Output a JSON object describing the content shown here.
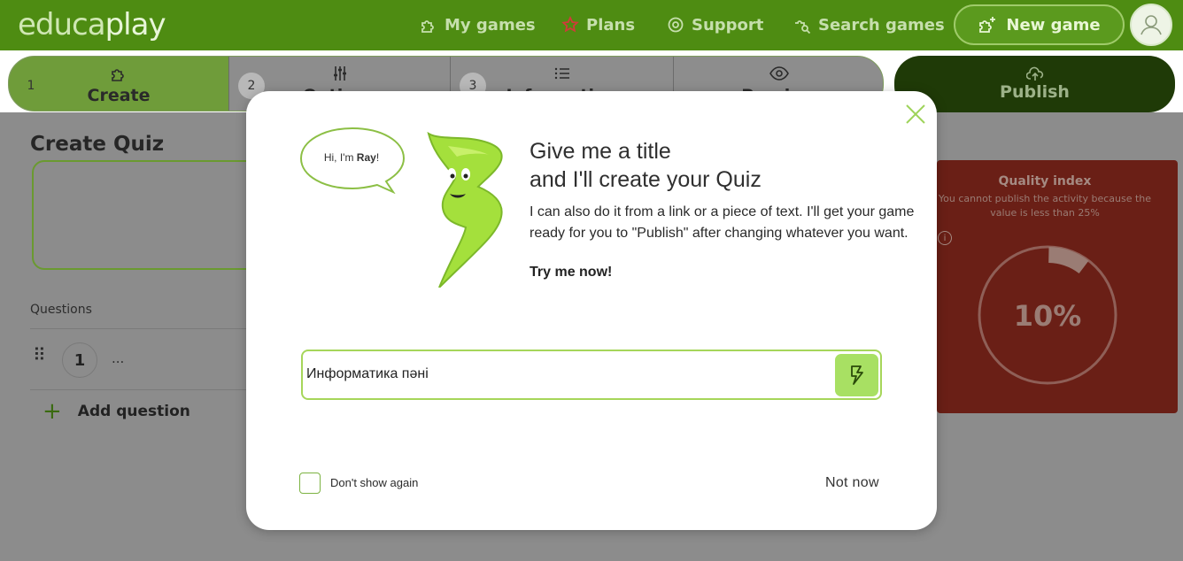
{
  "app": {
    "logo_main": "educa",
    "logo_accent": "play"
  },
  "nav": {
    "my_games": "My games",
    "plans": "Plans",
    "support": "Support",
    "search_games": "Search games",
    "new_game": "New game"
  },
  "steps": [
    {
      "num": "1",
      "label": "Create"
    },
    {
      "num": "2",
      "label": "Options"
    },
    {
      "num": "3",
      "label": "Information"
    },
    {
      "num": "",
      "label": "Preview"
    }
  ],
  "publish": {
    "label": "Publish"
  },
  "page": {
    "title": "Create Quiz",
    "questions_header": "Questions",
    "question_number": "1",
    "question_text": "...",
    "add_question": "Add question"
  },
  "quality": {
    "title": "Quality index",
    "subtitle": "You cannot publish the activity because the value is less than 25%",
    "value": "10%",
    "percent": 10
  },
  "modal": {
    "bubble_prefix": "Hi, I'm ",
    "bubble_name": "Ray",
    "bubble_suffix": "!",
    "heading_line1": "Give me a title",
    "heading_line2": "and I'll create your Quiz",
    "paragraph": "I can also do it from a link or a piece of text. I'll get your game ready for you to \"Publish\" after changing whatever you want.",
    "try_now": "Try me now!",
    "input_value": "Информатика пәні",
    "dont_show": "Don't show again",
    "not_now": "Not now"
  },
  "colors": {
    "brand_green": "#4e8c12",
    "accent_lime": "#a8e063",
    "publish_dark": "#1f3a07",
    "quality_red": "#6a1f16"
  }
}
